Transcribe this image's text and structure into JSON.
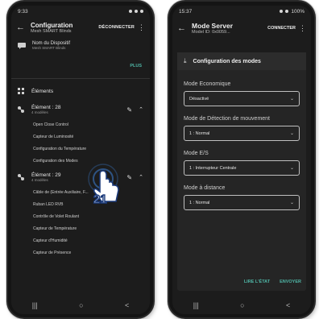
{
  "left": {
    "status": {
      "time": "9:33"
    },
    "appbar": {
      "title": "Configuration",
      "subtitle": "Mesh SMART Blinds",
      "action": "DÉCONNECTER"
    },
    "device": {
      "label": "Nom du Dispositif",
      "value": "Mesh SMART Blinds"
    },
    "plus": "PLUS",
    "elements_title": "Éléments",
    "element1": {
      "name": "Élément : 28",
      "models": "4 modèles"
    },
    "element1_items": [
      "Open Close Control",
      "Capteur de Luminosité",
      "Configuration du Température",
      "Configuration des Modes"
    ],
    "element2": {
      "name": "Élément : 29",
      "models": "4 modèles"
    },
    "element2_items": [
      "Câble de (Entrée Auxiliaire, F...",
      "Ruban LED RVB",
      "Contrôle de Volet Roulant",
      "Capteur de Température",
      "Capteur d'Humidité",
      "Capteur de Présence"
    ],
    "tap_badge": "21",
    "nav": [
      "|||",
      "○",
      "<"
    ]
  },
  "right": {
    "status": {
      "time": "15:37",
      "battery": "100%"
    },
    "appbar": {
      "title": "Mode Server",
      "subtitle": "Model ID: 0x0059...",
      "action": "CONNECTER"
    },
    "card_title": "Configuration des modes",
    "fields": [
      {
        "label": "Mode Economique",
        "value": "Désactivé"
      },
      {
        "label": "Mode de Détection de mouvement",
        "value": "1 : Normal"
      },
      {
        "label": "Mode E/S",
        "value": "1 : Interrupteur Centrale"
      },
      {
        "label": "Mode à distance",
        "value": "1 : Normal"
      }
    ],
    "actions": {
      "read": "LIRE L'ÉTAT",
      "send": "ENVOYER"
    },
    "nav": [
      "|||",
      "○",
      "<"
    ]
  },
  "colors": {
    "accent": "#4fb6a6",
    "background": "#1c1c1c"
  }
}
